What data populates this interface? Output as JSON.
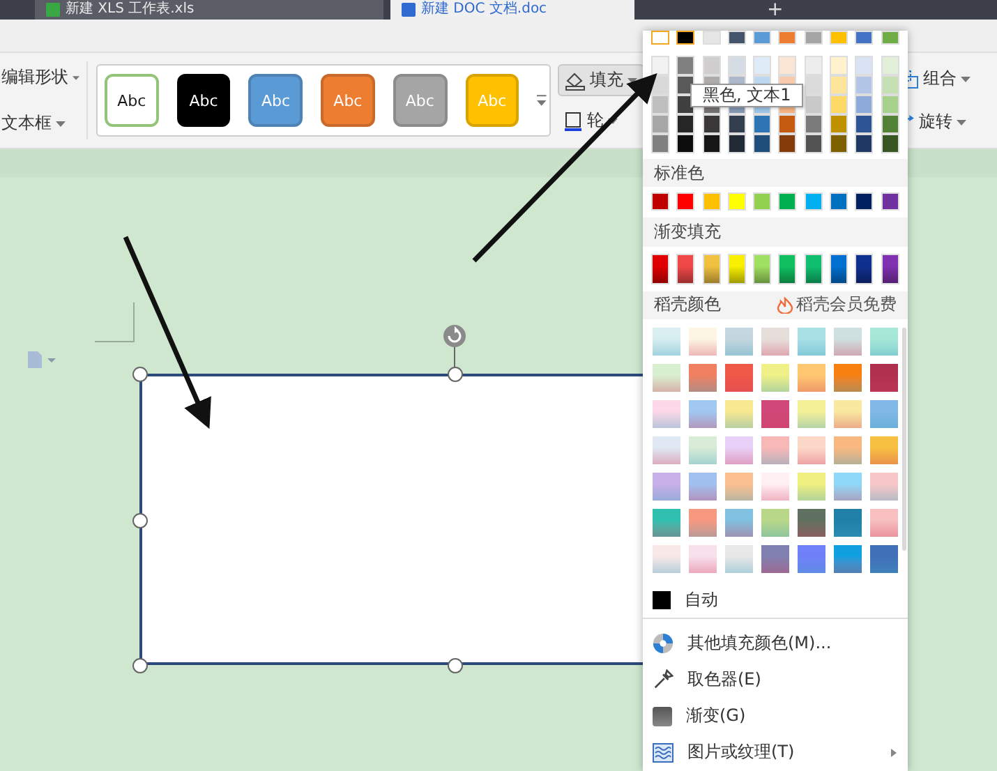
{
  "tabs": [
    {
      "label": "新建 XLS 工作表.xls",
      "selected": false,
      "kind": "sheet"
    },
    {
      "label": "新建 DOC 文档.doc",
      "selected": true,
      "kind": "doc"
    }
  ],
  "new_tab": "+",
  "ribbon": {
    "left": [
      {
        "label": "编辑形状"
      },
      {
        "label": "文本框"
      }
    ],
    "styles": [
      {
        "label": "Abc",
        "color": "#ffffff"
      },
      {
        "label": "Abc",
        "color": "#000000"
      },
      {
        "label": "Abc",
        "color": "#5b9bd5"
      },
      {
        "label": "Abc",
        "color": "#ed7d31"
      },
      {
        "label": "Abc",
        "color": "#a5a5a5"
      },
      {
        "label": "Abc",
        "color": "#ffc000"
      }
    ],
    "fill": {
      "label": "填充",
      "pressed": true
    },
    "outline": {
      "label": "轮"
    },
    "right": [
      {
        "label": "组合",
        "kind": "group"
      },
      {
        "label": "旋转",
        "kind": "rotate"
      }
    ]
  },
  "color_menu": {
    "theme": [
      {
        "color": "#ffffff",
        "selected": true,
        "shades": [
          {
            "color": "#f2f2f2"
          },
          {
            "color": "#d9d9d9"
          },
          {
            "color": "#bfbfbf"
          },
          {
            "color": "#a6a6a6"
          },
          {
            "color": "#808080"
          }
        ]
      },
      {
        "color": "#000000",
        "selected": true,
        "shades": [
          {
            "color": "#808080"
          },
          {
            "color": "#595959"
          },
          {
            "color": "#404040"
          },
          {
            "color": "#262626"
          },
          {
            "color": "#0d0d0d"
          }
        ]
      },
      {
        "color": "#e7e6e6",
        "selected": false,
        "shades": [
          {
            "color": "#d0cece"
          },
          {
            "color": "#aeabab"
          },
          {
            "color": "#757171"
          },
          {
            "color": "#3a3838"
          },
          {
            "color": "#171616"
          }
        ]
      },
      {
        "color": "#44546a",
        "selected": false,
        "shades": [
          {
            "color": "#d6dce4"
          },
          {
            "color": "#adb9ca"
          },
          {
            "color": "#8497b0"
          },
          {
            "color": "#333f4f"
          },
          {
            "color": "#222a35"
          }
        ]
      },
      {
        "color": "#5b9bd5",
        "selected": false,
        "shades": [
          {
            "color": "#deebf6"
          },
          {
            "color": "#bdd7ee"
          },
          {
            "color": "#9dc3e6"
          },
          {
            "color": "#2e75b5"
          },
          {
            "color": "#1e4e79"
          }
        ]
      },
      {
        "color": "#ed7d31",
        "selected": false,
        "shades": [
          {
            "color": "#fbe5d5"
          },
          {
            "color": "#f7cbac"
          },
          {
            "color": "#f4b183"
          },
          {
            "color": "#c55a11"
          },
          {
            "color": "#843c0b"
          }
        ]
      },
      {
        "color": "#a5a5a5",
        "selected": false,
        "shades": [
          {
            "color": "#ededed"
          },
          {
            "color": "#dbdbdb"
          },
          {
            "color": "#c9c9c9"
          },
          {
            "color": "#7b7b7b"
          },
          {
            "color": "#525252"
          }
        ]
      },
      {
        "color": "#ffc000",
        "selected": false,
        "shades": [
          {
            "color": "#fff2cc"
          },
          {
            "color": "#fee599"
          },
          {
            "color": "#ffd965"
          },
          {
            "color": "#bf9000"
          },
          {
            "color": "#7f6000"
          }
        ]
      },
      {
        "color": "#4472c4",
        "selected": false,
        "shades": [
          {
            "color": "#dae3f3"
          },
          {
            "color": "#b4c6e7"
          },
          {
            "color": "#8eaadb"
          },
          {
            "color": "#2f5496"
          },
          {
            "color": "#1f3864"
          }
        ]
      },
      {
        "color": "#70ad47",
        "selected": false,
        "shades": [
          {
            "color": "#e2efd9"
          },
          {
            "color": "#c5e0b3"
          },
          {
            "color": "#a8d08d"
          },
          {
            "color": "#538135"
          },
          {
            "color": "#375623"
          }
        ]
      }
    ],
    "tooltip": "黑色, 文本1",
    "standard_title": "标准色",
    "standard": [
      {
        "color": "#c00000"
      },
      {
        "color": "#ff0000"
      },
      {
        "color": "#ffc000"
      },
      {
        "color": "#ffff00"
      },
      {
        "color": "#92d050"
      },
      {
        "color": "#00b050"
      },
      {
        "color": "#00b0f0"
      },
      {
        "color": "#0070c0"
      },
      {
        "color": "#002060"
      },
      {
        "color": "#7030a0"
      }
    ],
    "gradient_title": "渐变填充",
    "gradients": [
      {
        "color": "#e00000"
      },
      {
        "color": "#f04848"
      },
      {
        "color": "#f0c040"
      },
      {
        "color": "#f8f000"
      },
      {
        "color": "#a0e060"
      },
      {
        "color": "#10c060"
      },
      {
        "color": "#10c070"
      },
      {
        "color": "#0070d0"
      },
      {
        "color": "#103090"
      },
      {
        "color": "#8030b0"
      }
    ],
    "docer_title": "稻壳颜色",
    "docer_badge": "稻壳会员免费",
    "docer": [
      {
        "color": "#d8eef0"
      },
      {
        "color": "#fdf6e3"
      },
      {
        "color": "#c4d6df"
      },
      {
        "color": "#e6dedb"
      },
      {
        "color": "#a8e0e6"
      },
      {
        "color": "#cfe0e0"
      },
      {
        "color": "#a6e8d8"
      },
      {
        "color": "#d8f0d0"
      },
      {
        "color": "#f08060"
      },
      {
        "color": "#f05848"
      },
      {
        "color": "#f0f088"
      },
      {
        "color": "#ffc870"
      },
      {
        "color": "#f88010"
      },
      {
        "color": "#b03050"
      },
      {
        "color": "#fcd8e8"
      },
      {
        "color": "#a0c8f0"
      },
      {
        "color": "#f8e890"
      },
      {
        "color": "#d04878"
      },
      {
        "color": "#f4f098"
      },
      {
        "color": "#f8e8a0"
      },
      {
        "color": "#80b8e8"
      },
      {
        "color": "#e0e8f4"
      },
      {
        "color": "#d8ecd8"
      },
      {
        "color": "#e8d0f8"
      },
      {
        "color": "#f8b8b8"
      },
      {
        "color": "#fcd8c8"
      },
      {
        "color": "#f8b880"
      },
      {
        "color": "#f8c040"
      },
      {
        "color": "#c8b0e8"
      },
      {
        "color": "#a0c0f0"
      },
      {
        "color": "#fcc090"
      },
      {
        "color": "#fff0f4"
      },
      {
        "color": "#f0f080"
      },
      {
        "color": "#90d8f8"
      },
      {
        "color": "#f8c8c8"
      },
      {
        "color": "#30c0b0"
      },
      {
        "color": "#f89880"
      },
      {
        "color": "#80c0e0"
      },
      {
        "color": "#b8d888"
      },
      {
        "color": "#607060"
      },
      {
        "color": "#2080a8"
      },
      {
        "color": "#f8c0c0"
      },
      {
        "color": "#f8e8e8"
      },
      {
        "color": "#f8e0ec"
      },
      {
        "color": "#e8e8e8"
      },
      {
        "color": "#8080b0"
      },
      {
        "color": "#7080f8"
      },
      {
        "color": "#10a0e0"
      },
      {
        "color": "#4070b8"
      }
    ],
    "items": [
      {
        "kind": "auto",
        "label": "自动",
        "submenu": false
      },
      {
        "kind": "more",
        "label": "其他填充颜色(M)...",
        "submenu": false
      },
      {
        "kind": "picker",
        "label": "取色器(E)",
        "submenu": false
      },
      {
        "kind": "gradient",
        "label": "渐变(G)",
        "submenu": false
      },
      {
        "kind": "texture",
        "label": "图片或纹理(T)",
        "submenu": true
      }
    ]
  }
}
